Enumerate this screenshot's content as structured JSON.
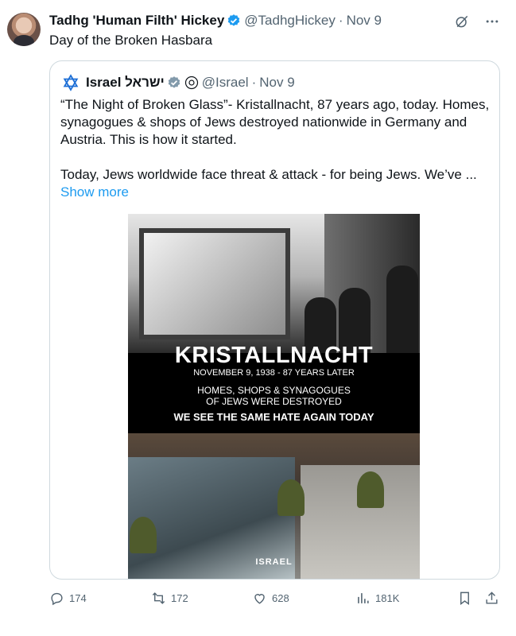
{
  "post": {
    "author_name": "Tadhg 'Human Filth' Hickey",
    "author_handle": "@TadhgHickey",
    "separator": "·",
    "date": "Nov 9",
    "text": "Day of the Broken Hasbara"
  },
  "quoted": {
    "author_name": "Israel ישראל",
    "author_handle": "@Israel",
    "separator": "·",
    "date": "Nov 9",
    "text": "“The Night of Broken Glass”- Kristallnacht, 87 years ago, today. Homes, synagogues & shops of Jews destroyed nationwide in Germany and Austria. This is how it started.\n\nToday, Jews worldwide face threat & attack - for being Jews. We’ve ...",
    "show_more": "Show more",
    "image": {
      "title": "KRISTALLNACHT",
      "subtitle": "NOVEMBER 9, 1938 - 87 YEARS LATER",
      "line2": "HOMES, SHOPS & SYNAGOGUES\nOF JEWS WERE DESTROYED",
      "line3": "WE SEE THE SAME HATE AGAIN TODAY",
      "logo": "ISRAEL"
    }
  },
  "actions": {
    "replies": "174",
    "reposts": "172",
    "likes": "628",
    "views": "181K"
  },
  "icons": {
    "verified": "verified-badge-icon",
    "grok": "grok-icon",
    "more": "more-icon",
    "reply": "reply-icon",
    "repost": "repost-icon",
    "like": "heart-icon",
    "views": "views-icon",
    "bookmark": "bookmark-icon",
    "share": "share-icon"
  },
  "colors": {
    "accent": "#1d9bf0",
    "text": "#0f1419",
    "muted": "#536471",
    "border": "#cfd9de"
  }
}
